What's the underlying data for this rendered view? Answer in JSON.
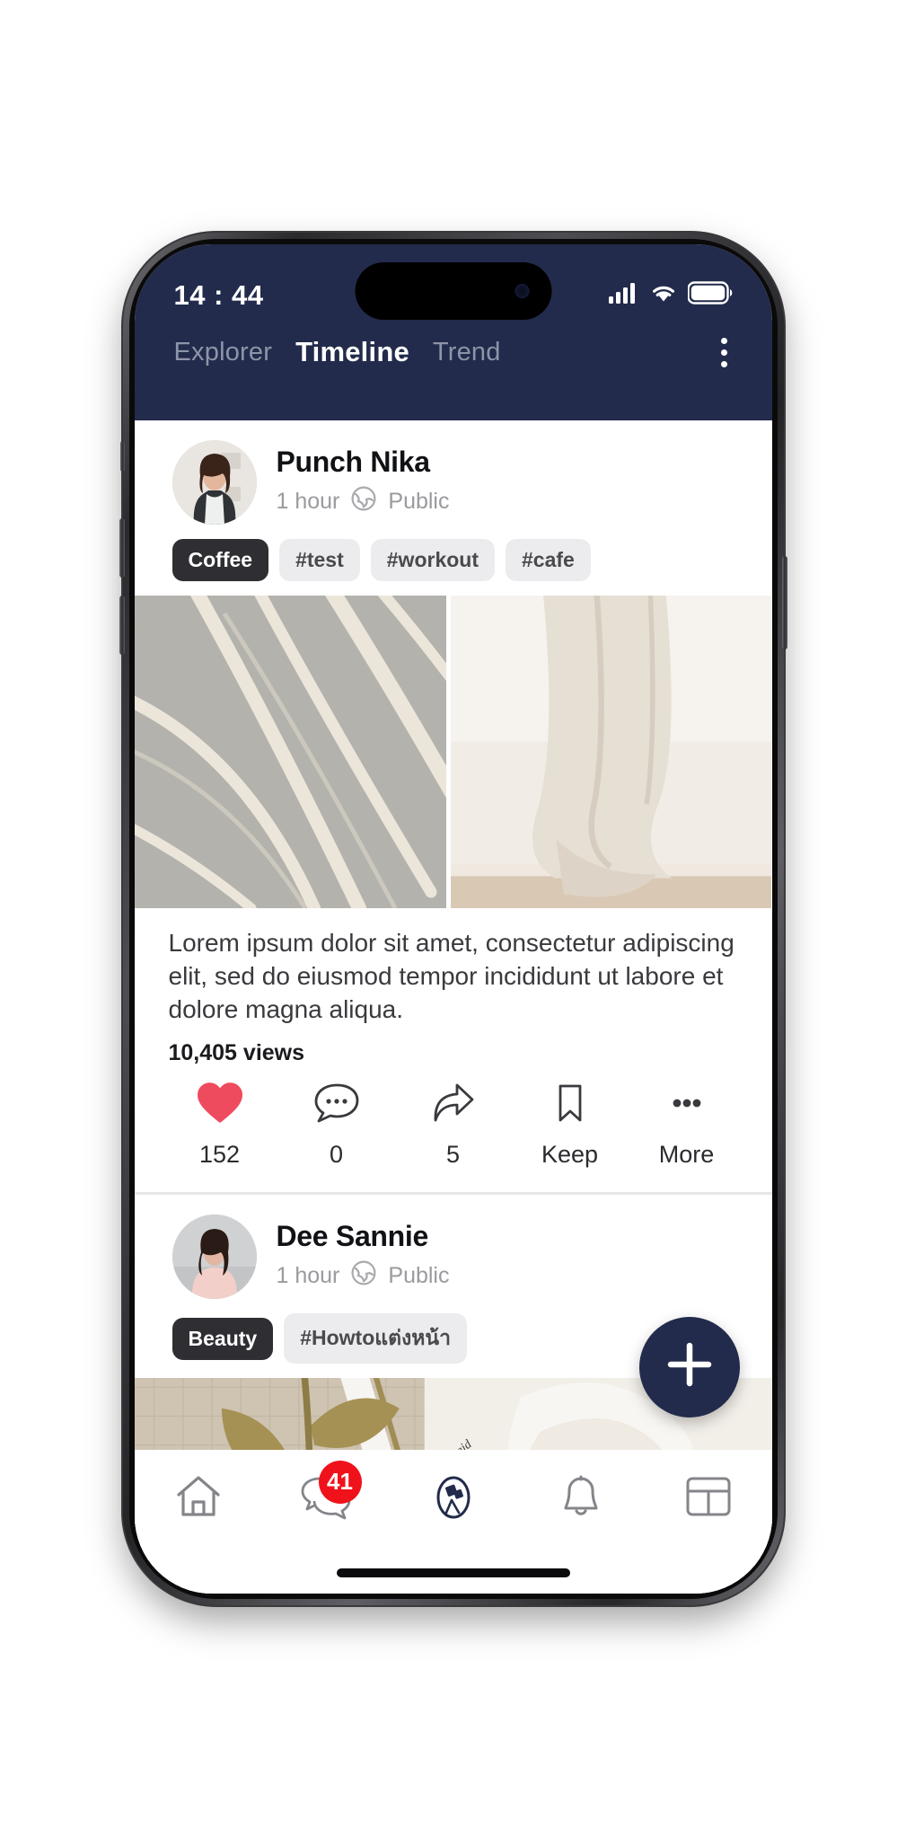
{
  "status_bar": {
    "time": "14 : 44",
    "signal_icon": "cellular-signal-icon",
    "wifi_icon": "wifi-icon",
    "battery_icon": "battery-icon"
  },
  "header": {
    "background_color": "#222b4b",
    "tabs": [
      {
        "label": "Explorer",
        "active": false
      },
      {
        "label": "Timeline",
        "active": true
      },
      {
        "label": "Trend",
        "active": false
      }
    ],
    "overflow_icon": "kebab-menu-icon"
  },
  "posts": [
    {
      "author": "Punch Nika",
      "time": "1 hour",
      "privacy": "Public",
      "privacy_icon": "globe-icon",
      "tags": [
        {
          "label": "Coffee",
          "style": "primary"
        },
        {
          "label": "#test",
          "style": "muted"
        },
        {
          "label": "#workout",
          "style": "muted"
        },
        {
          "label": "#cafe",
          "style": "muted"
        }
      ],
      "caption": "Lorem ipsum dolor sit amet, consectetur adipiscing elit, sed  do eiusmod tempor incididunt ut labore et dolore magna aliqua.",
      "views": "10,405 views",
      "actions": [
        {
          "icon": "heart-filled-icon",
          "label": "152",
          "color": "#ef4b5e"
        },
        {
          "icon": "comment-bubble-icon",
          "label": "0",
          "color": "#3a3a3e"
        },
        {
          "icon": "share-arrow-icon",
          "label": "5",
          "color": "#3a3a3e"
        },
        {
          "icon": "bookmark-icon",
          "label": "Keep",
          "color": "#3a3a3e"
        },
        {
          "icon": "more-dots-icon",
          "label": "More",
          "color": "#3a3a3e"
        }
      ]
    },
    {
      "author": "Dee Sannie",
      "time": "1 hour",
      "privacy": "Public",
      "privacy_icon": "globe-icon",
      "tags": [
        {
          "label": "Beauty",
          "style": "primary"
        },
        {
          "label": "#Howtoแต่งหน้า",
          "style": "muted"
        }
      ]
    }
  ],
  "fab": {
    "icon": "plus-icon",
    "color": "#222b4b"
  },
  "bottom_nav": {
    "items": [
      {
        "icon": "home-icon",
        "badge": null,
        "active": false
      },
      {
        "icon": "chat-bubbles-icon",
        "badge": "41",
        "active": false
      },
      {
        "icon": "telescope-icon",
        "badge": null,
        "active": true
      },
      {
        "icon": "bell-icon",
        "badge": null,
        "active": false
      },
      {
        "icon": "grid-layout-icon",
        "badge": null,
        "active": false
      }
    ],
    "badge_color": "#f0121b",
    "active_color": "#222b4b"
  }
}
